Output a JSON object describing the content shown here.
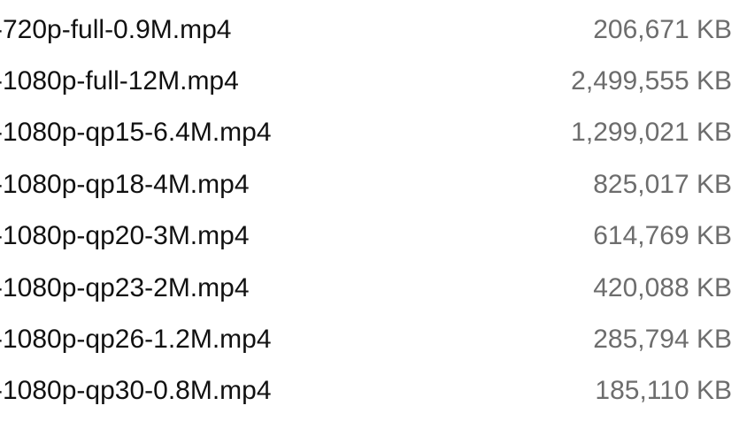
{
  "files": [
    {
      "name": "-720p-full-0.9M.mp4",
      "size": "206,671 KB"
    },
    {
      "name": "-1080p-full-12M.mp4",
      "size": "2,499,555 KB"
    },
    {
      "name": "-1080p-qp15-6.4M.mp4",
      "size": "1,299,021 KB"
    },
    {
      "name": "-1080p-qp18-4M.mp4",
      "size": "825,017 KB"
    },
    {
      "name": "-1080p-qp20-3M.mp4",
      "size": "614,769 KB"
    },
    {
      "name": "-1080p-qp23-2M.mp4",
      "size": "420,088 KB"
    },
    {
      "name": "-1080p-qp26-1.2M.mp4",
      "size": "285,794 KB"
    },
    {
      "name": "-1080p-qp30-0.8M.mp4",
      "size": "185,110 KB"
    }
  ]
}
